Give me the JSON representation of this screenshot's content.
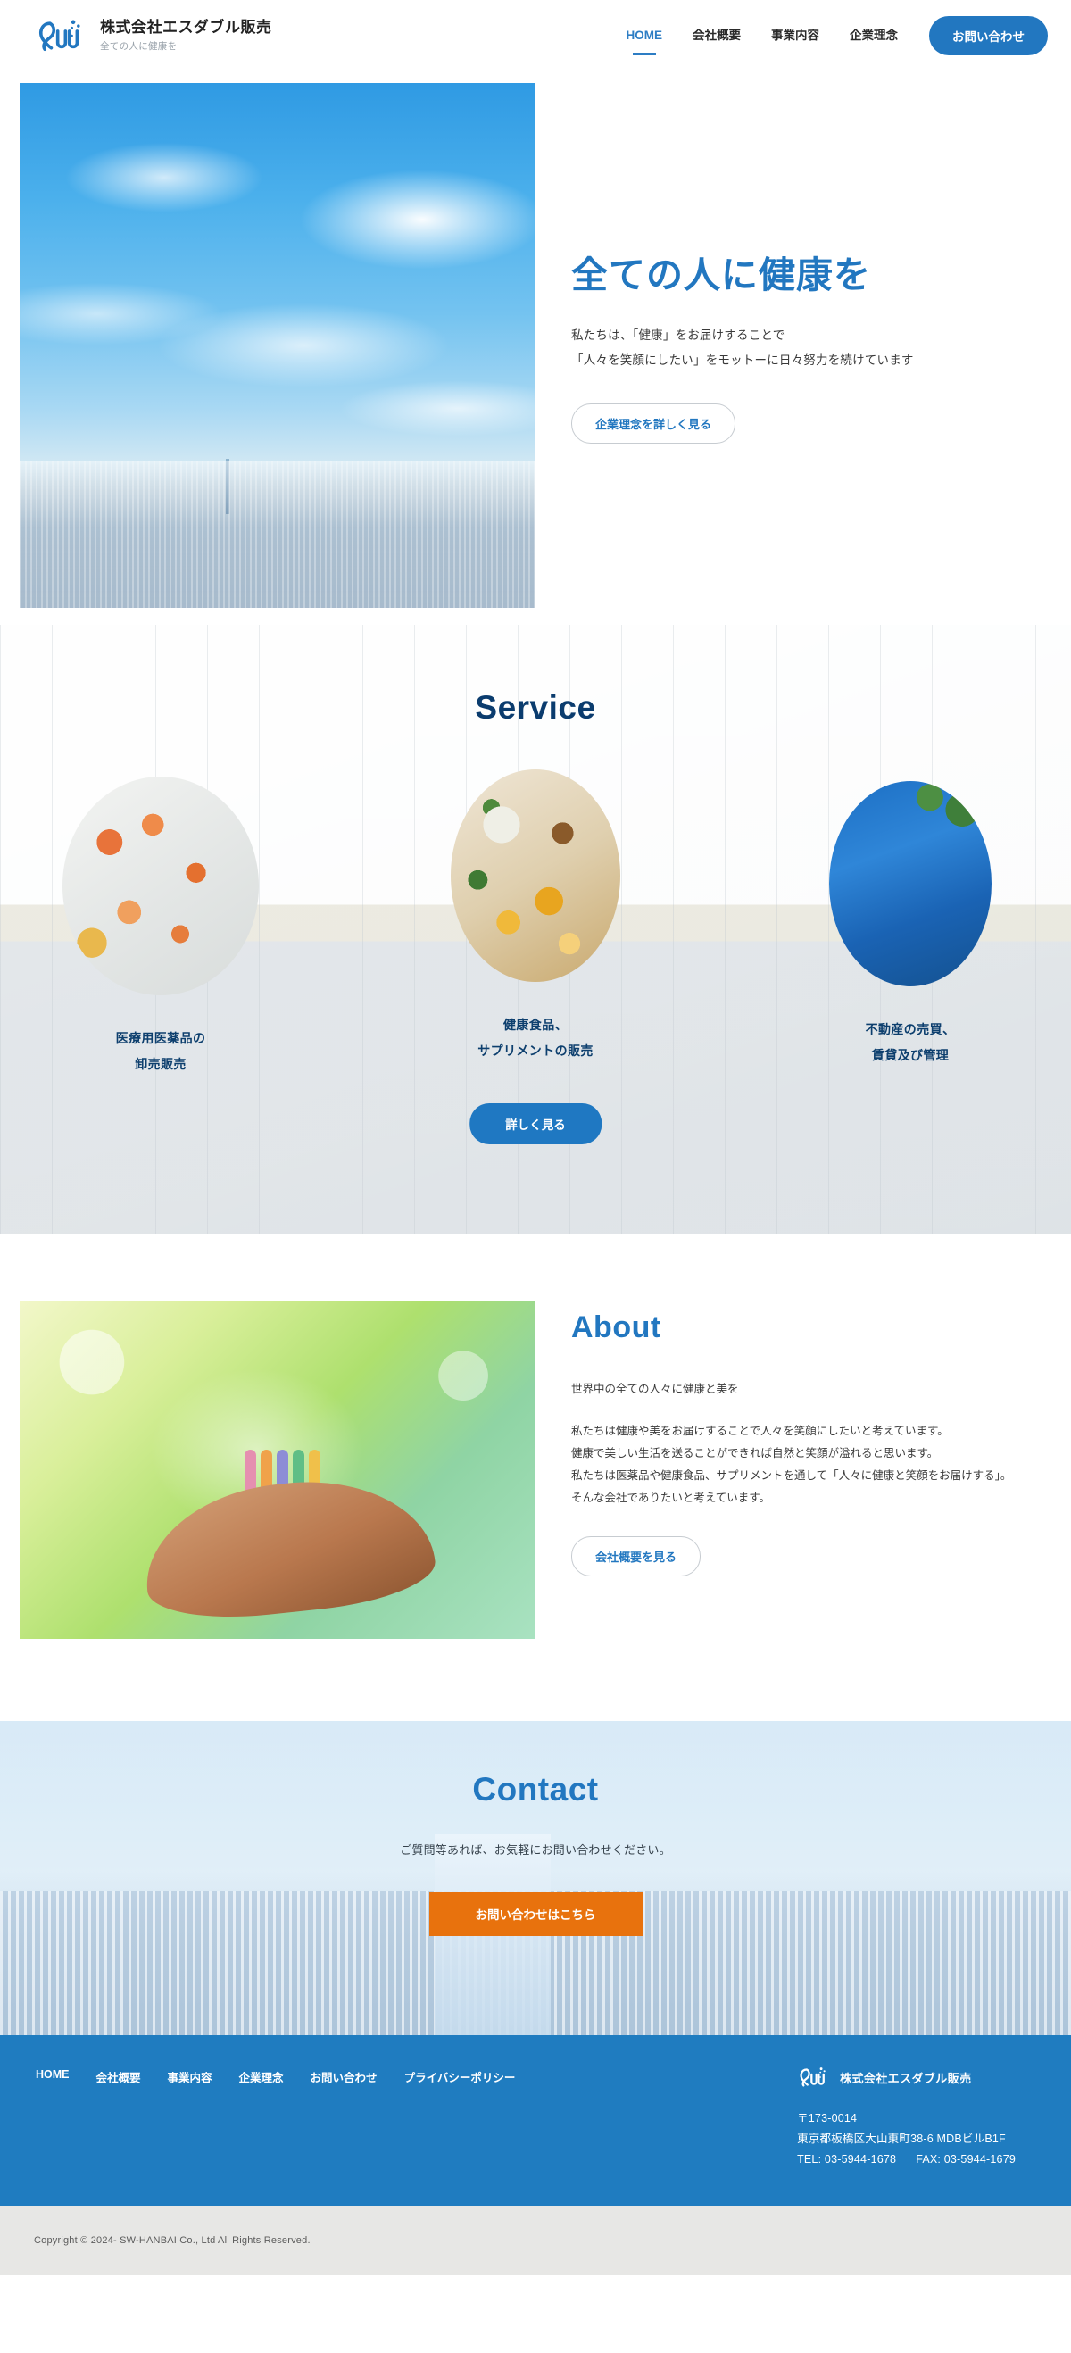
{
  "header": {
    "logo_icon": "sw-logo-icon",
    "brand_name": "株式会社エスダブル販売",
    "brand_tagline": "全ての人に健康を",
    "nav": [
      {
        "label": "HOME",
        "active": true
      },
      {
        "label": "会社概要",
        "active": false
      },
      {
        "label": "事業内容",
        "active": false
      },
      {
        "label": "企業理念",
        "active": false
      }
    ],
    "cta_label": "お問い合わせ"
  },
  "hero": {
    "image_alt": "青空と東京の街並み",
    "title": "全ての人に健康を",
    "lead_line1": "私たちは、「健康」をお届けすることで",
    "lead_line2": "「人々を笑顔にしたい」をモットーに日々努力を続けています",
    "button_label": "企業理念を詳しく見る"
  },
  "service": {
    "title": "Service",
    "title_color": "#0b3c6e",
    "background_alt": "オフィスの風景",
    "cards": [
      {
        "image_alt": "医療用医薬品の写真",
        "line1": "医療用医薬品の",
        "line2": "卸売販売"
      },
      {
        "image_alt": "健康食品・サプリメントの写真",
        "line1": "健康食品、",
        "line2": "サプリメントの販売"
      },
      {
        "image_alt": "ビルと緑の写真",
        "line1": "不動産の売買、",
        "line2": "賃貸及び管理"
      }
    ],
    "button_label": "詳しく見る"
  },
  "about": {
    "title": "About",
    "image_alt": "手のひらに乗る人々のイラスト",
    "lede": "世界中の全ての人々に健康と美を",
    "body_line1": "私たちは健康や美をお届けすることで人々を笑顔にしたいと考えています。",
    "body_line2": "健康で美しい生活を送ることができれば自然と笑顔が溢れると思います。",
    "body_line3": "私たちは医薬品や健康食品、サプリメントを通して「人々に健康と笑顔をお届けする」。",
    "body_line4": "そんな会社でありたいと考えています。",
    "button_label": "会社概要を見る"
  },
  "contact": {
    "title": "Contact",
    "background_alt": "都市のビル群",
    "lead": "ご質問等あれば、お気軽にお問い合わせください。",
    "button_label": "お問い合わせはこちら",
    "button_color": "#e8720d"
  },
  "footer": {
    "nav": [
      {
        "label": "HOME"
      },
      {
        "label": "会社概要"
      },
      {
        "label": "事業内容"
      },
      {
        "label": "企業理念"
      },
      {
        "label": "お問い合わせ"
      },
      {
        "label": "プライバシーポリシー"
      }
    ],
    "logo_icon": "sw-logo-icon",
    "brand_name": "株式会社エスダブル販売",
    "postal_code": "〒173-0014",
    "address": "東京都板橋区大山東町38-6 MDBビルB1F",
    "tel": "TEL: 03-5944-1678",
    "fax": "FAX: 03-5944-1679",
    "background_color": "#1f7cc0"
  },
  "copyright": {
    "text": "Copyright © 2024-   SW-HANBAI Co., Ltd All Rights Reserved."
  }
}
